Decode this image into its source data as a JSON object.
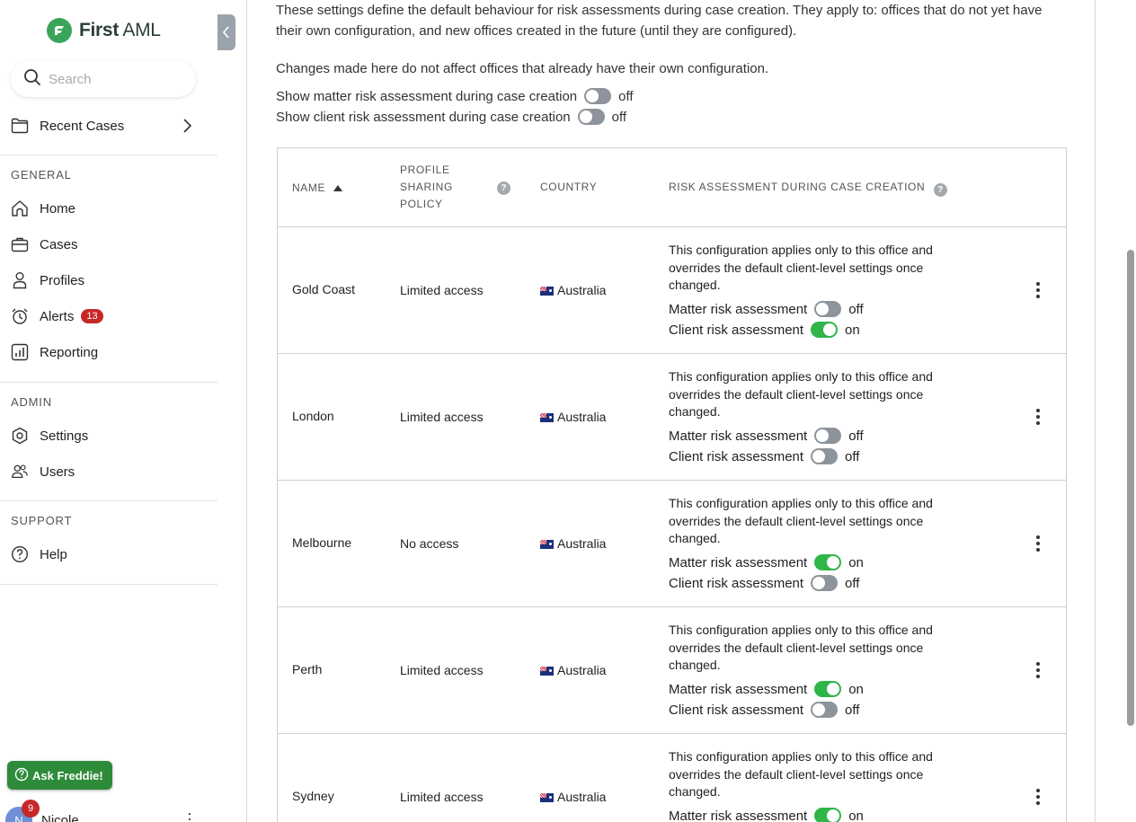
{
  "brand": {
    "name_bold": "First",
    "name_rest": " AML"
  },
  "search": {
    "placeholder": "Search"
  },
  "recent_cases": {
    "label": "Recent Cases"
  },
  "sections": {
    "general": "GENERAL",
    "admin": "ADMIN",
    "support": "SUPPORT"
  },
  "nav": {
    "home": "Home",
    "cases": "Cases",
    "profiles": "Profiles",
    "alerts": "Alerts",
    "alerts_count": "13",
    "reporting": "Reporting",
    "settings": "Settings",
    "users": "Users",
    "help": "Help"
  },
  "ask_freddie": {
    "label": "Ask Freddie!"
  },
  "user": {
    "name": "Nicole",
    "initial": "N",
    "notifications": "9"
  },
  "intro": {
    "text": "These settings define the default behaviour for risk assessments during case creation. They apply to: offices that do not yet have their own configuration, and new offices created in the future (until they are configured).",
    "note": "Changes made here do not affect offices that already have their own configuration."
  },
  "defaults": {
    "matter": {
      "label": "Show matter risk assessment during case creation",
      "state": "off"
    },
    "client": {
      "label": "Show client risk assessment during case creation",
      "state": "off"
    }
  },
  "table": {
    "headers": {
      "name": "NAME",
      "policy_1": "PROFILE",
      "policy_2": "SHARING",
      "policy_3": "POLICY",
      "country": "COUNTRY",
      "risk": "RISK ASSESSMENT DURING CASE CREATION",
      "help_glyph": "?"
    },
    "row_desc": "This configuration applies only to this office and overrides the default client-level settings once changed.",
    "matter_label": "Matter risk assessment",
    "client_label": "Client risk assessment",
    "rows": [
      {
        "name": "Gold Coast",
        "policy": "Limited access",
        "country": "Australia",
        "matter": "off",
        "client": "on"
      },
      {
        "name": "London",
        "policy": "Limited access",
        "country": "Australia",
        "matter": "off",
        "client": "off"
      },
      {
        "name": "Melbourne",
        "policy": "No access",
        "country": "Australia",
        "matter": "on",
        "client": "off"
      },
      {
        "name": "Perth",
        "policy": "Limited access",
        "country": "Australia",
        "matter": "on",
        "client": "off"
      },
      {
        "name": "Sydney",
        "policy": "Limited access",
        "country": "Australia",
        "matter": "on",
        "client": ""
      }
    ]
  },
  "colors": {
    "accent": "#2fb548",
    "brand_green": "#3aa55a",
    "alert_red": "#c62828"
  }
}
